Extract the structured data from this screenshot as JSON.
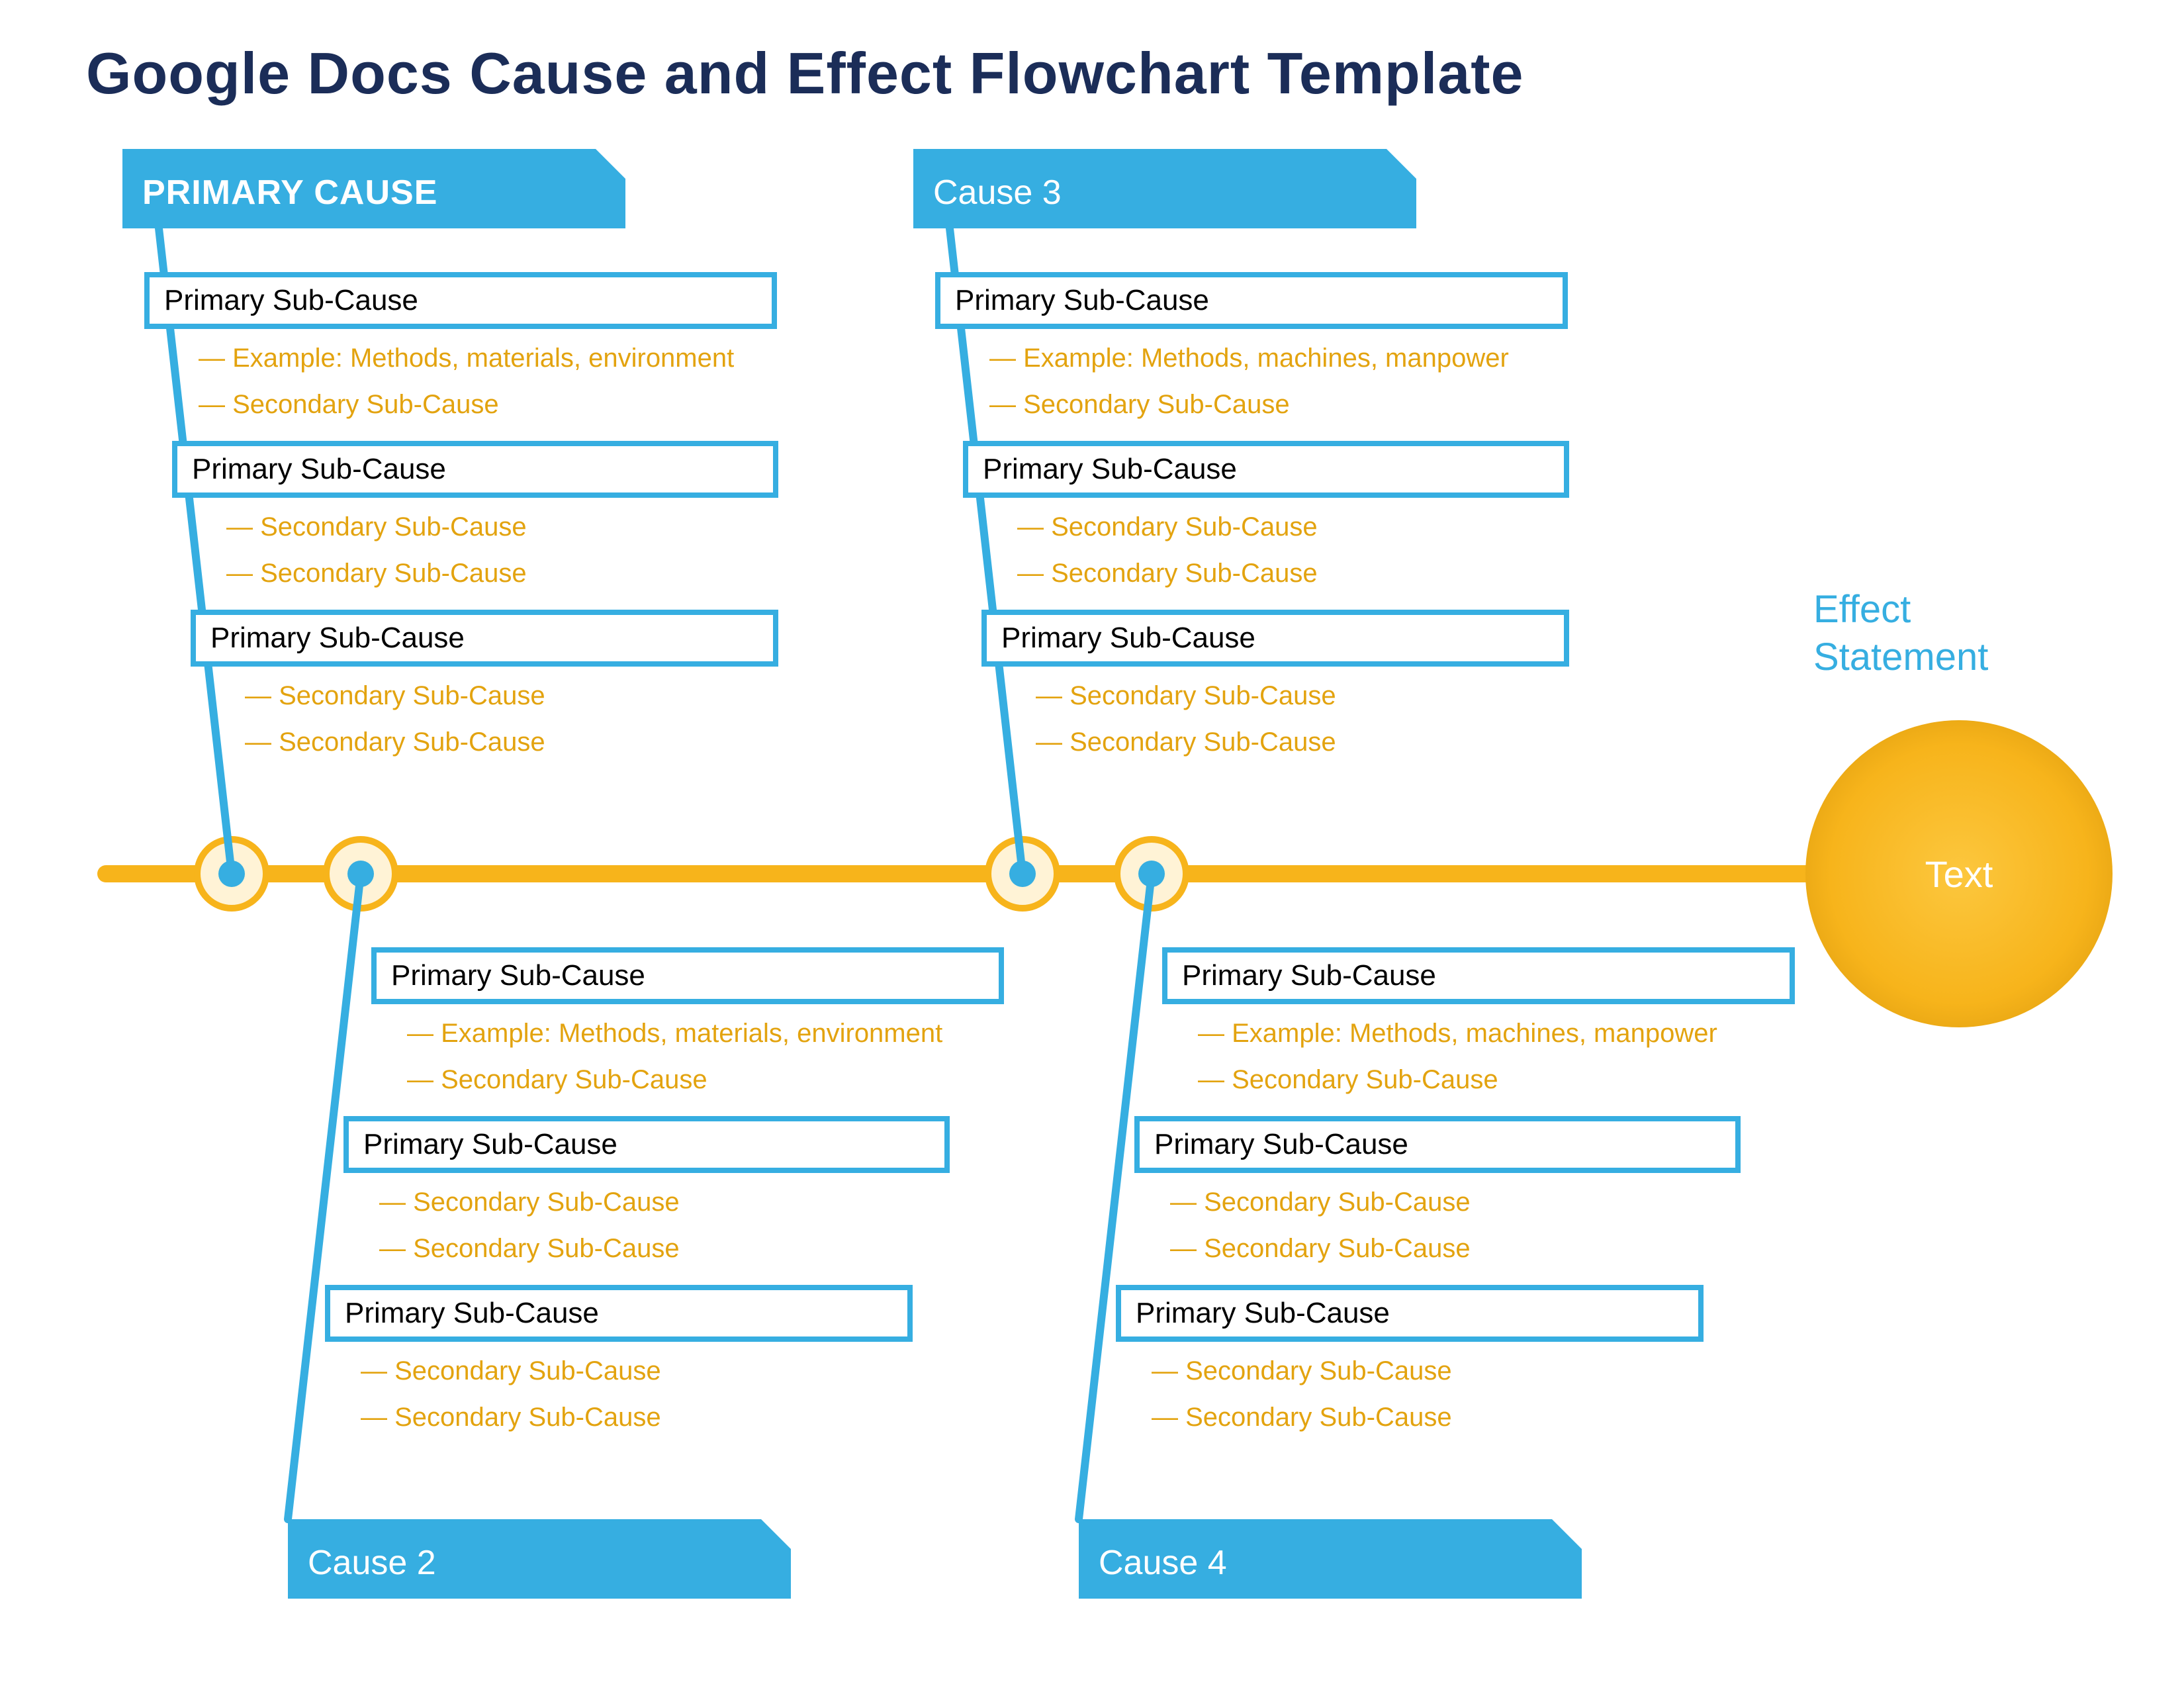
{
  "title": "Google Docs Cause and Effect Flowchart Template",
  "colors": {
    "blue": "#36aee1",
    "amber": "#f7b41b",
    "amber_pale": "#fff3d6",
    "amber_text": "#e3a30f",
    "navy": "#1b2d58",
    "text_black": "#000000",
    "white": "#ffffff"
  },
  "effect": {
    "label_line1": "Effect",
    "label_line2": "Statement",
    "circle_text": "Text"
  },
  "cause1": {
    "title": "PRIMARY CAUSE",
    "title_bold": true,
    "sub1": "Primary Sub-Cause",
    "sub1_sec1": "Example: Methods, materials, environment",
    "sub1_sec2": "Secondary Sub-Cause",
    "sub2": "Primary Sub-Cause",
    "sub2_sec1": "Secondary Sub-Cause",
    "sub2_sec2": "Secondary Sub-Cause",
    "sub3": "Primary Sub-Cause",
    "sub3_sec1": "Secondary Sub-Cause",
    "sub3_sec2": "Secondary Sub-Cause"
  },
  "cause2": {
    "title": "Cause 2",
    "title_bold": false,
    "sub1": "Primary Sub-Cause",
    "sub1_sec1": "Example: Methods, materials, environment",
    "sub1_sec2": "Secondary Sub-Cause",
    "sub2": "Primary Sub-Cause",
    "sub2_sec1": "Secondary Sub-Cause",
    "sub2_sec2": "Secondary Sub-Cause",
    "sub3": "Primary Sub-Cause",
    "sub3_sec1": "Secondary Sub-Cause",
    "sub3_sec2": "Secondary Sub-Cause"
  },
  "cause3": {
    "title": "Cause 3",
    "title_bold": false,
    "sub1": "Primary Sub-Cause",
    "sub1_sec1": "Example: Methods, machines, manpower",
    "sub1_sec2": "Secondary Sub-Cause",
    "sub2": "Primary Sub-Cause",
    "sub2_sec1": "Secondary Sub-Cause",
    "sub2_sec2": "Secondary Sub-Cause",
    "sub3": "Primary Sub-Cause",
    "sub3_sec1": "Secondary Sub-Cause",
    "sub3_sec2": "Secondary Sub-Cause"
  },
  "cause4": {
    "title": "Cause 4",
    "title_bold": false,
    "sub1": "Primary Sub-Cause",
    "sub1_sec1": "Example: Methods, machines, manpower",
    "sub1_sec2": "Secondary Sub-Cause",
    "sub2": "Primary Sub-Cause",
    "sub2_sec1": "Secondary Sub-Cause",
    "sub2_sec2": "Secondary Sub-Cause",
    "sub3": "Primary Sub-Cause",
    "sub3_sec1": "Secondary Sub-Cause",
    "sub3_sec2": "Secondary Sub-Cause"
  }
}
